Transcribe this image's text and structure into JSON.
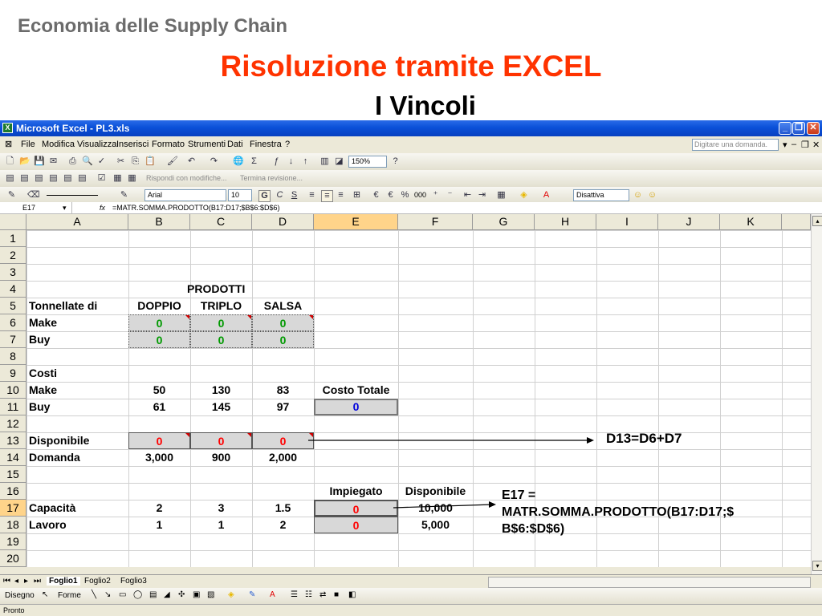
{
  "slide": {
    "header": "Economia delle Supply Chain",
    "title": "Risoluzione tramite EXCEL",
    "subtitle": "I Vincoli"
  },
  "window": {
    "title": "Microsoft Excel - PL3.xls",
    "menu": [
      "File",
      "Modifica",
      "Visualizza",
      "Inserisci",
      "Formato",
      "Strumenti",
      "Dati",
      "Finestra",
      "?"
    ],
    "help_placeholder": "Digitare una domanda."
  },
  "toolbar": {
    "zoom": "150%",
    "review_reply": "Rispondi con modifiche...",
    "review_end": "Termina revisione...",
    "font": "Arial",
    "size": "10",
    "bold": "G",
    "italic": "C",
    "underline": "S",
    "percent": "%",
    "thousands": "000",
    "style_box": "Disattiva"
  },
  "formula": {
    "cell_ref": "E17",
    "fx": "fx",
    "content": "=MATR.SOMMA.PRODOTTO(B17:D17;$B$6:$D$6)"
  },
  "sheet": {
    "columns": [
      "A",
      "B",
      "C",
      "D",
      "E",
      "F",
      "G",
      "H",
      "I",
      "J",
      "K"
    ],
    "rows": [
      "1",
      "2",
      "3",
      "4",
      "5",
      "6",
      "7",
      "8",
      "9",
      "10",
      "11",
      "12",
      "13",
      "14",
      "15",
      "16",
      "17",
      "18",
      "19",
      "20"
    ],
    "r4": {
      "d": "PRODOTTI"
    },
    "r5": {
      "a": "Tonnellate di",
      "b": "DOPPIO",
      "c": "TRIPLO",
      "d": "SALSA"
    },
    "r6": {
      "a": "Make",
      "b": "0",
      "c": "0",
      "d": "0"
    },
    "r7": {
      "a": "Buy",
      "b": "0",
      "c": "0",
      "d": "0"
    },
    "r9": {
      "a": "Costi"
    },
    "r10": {
      "a": "Make",
      "b": "50",
      "c": "130",
      "d": "83",
      "e": "Costo Totale"
    },
    "r11": {
      "a": "Buy",
      "b": "61",
      "c": "145",
      "d": "97",
      "e": "0"
    },
    "r13": {
      "a": "Disponibile",
      "b": "0",
      "c": "0",
      "d": "0"
    },
    "r14": {
      "a": "Domanda",
      "b": "3,000",
      "c": "900",
      "d": "2,000"
    },
    "r16": {
      "e": "Impiegato",
      "f": "Disponibile"
    },
    "r17": {
      "a": "Capacità",
      "b": "2",
      "c": "3",
      "d": "1.5",
      "e": "0",
      "f": "10,000"
    },
    "r18": {
      "a": "Lavoro",
      "b": "1",
      "c": "1",
      "d": "2",
      "e": "0",
      "f": "5,000"
    }
  },
  "annotations": {
    "d13": "D13=D6+D7",
    "e17_line1": "E17 =",
    "e17_line2": "MATR.SOMMA.PRODOTTO(B17:D17;$",
    "e17_line3": "B$6:$D$6)"
  },
  "tabs": [
    "Foglio1",
    "Foglio2",
    "Foglio3"
  ],
  "drawbar": {
    "disegno": "Disegno",
    "forme": "Forme"
  },
  "status": "Pronto"
}
